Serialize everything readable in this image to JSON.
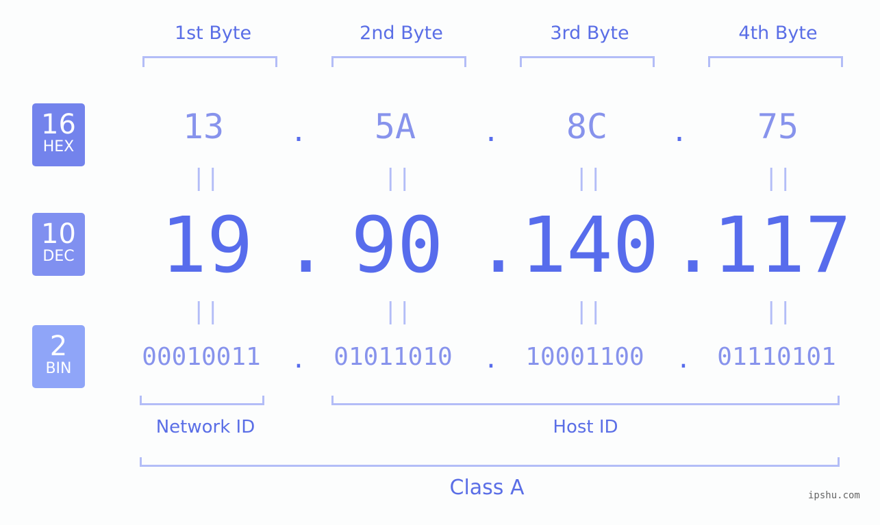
{
  "bytes": [
    {
      "label": "1st Byte",
      "hex": "13",
      "dec": "19",
      "bin": "00010011"
    },
    {
      "label": "2nd Byte",
      "hex": "5A",
      "dec": "90",
      "bin": "01011010"
    },
    {
      "label": "3rd Byte",
      "hex": "8C",
      "dec": "140",
      "bin": "10001100"
    },
    {
      "label": "4th Byte",
      "hex": "75",
      "dec": "117",
      "bin": "01110101"
    }
  ],
  "badges": {
    "hex": {
      "num": "16",
      "label": "HEX",
      "color": "#7383ec"
    },
    "dec": {
      "num": "10",
      "label": "DEC",
      "color": "#8090f0"
    },
    "bin": {
      "num": "2",
      "label": "BIN",
      "color": "#8fa5f8"
    }
  },
  "separator": ".",
  "equals": "||",
  "network_label": "Network ID",
  "host_label": "Host ID",
  "class_label": "Class A",
  "watermark": "ipshu.com"
}
